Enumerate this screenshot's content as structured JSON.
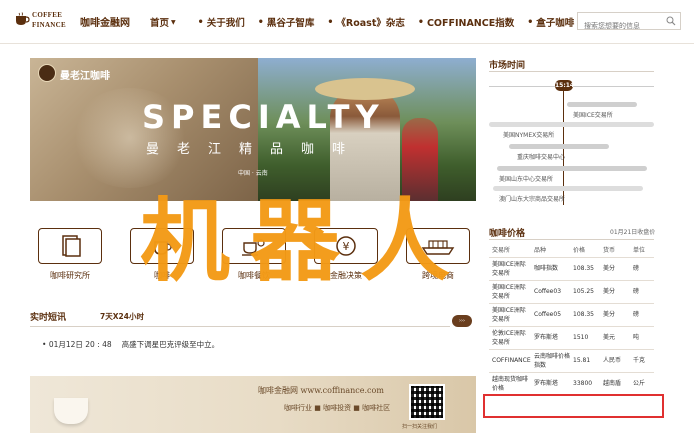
{
  "header": {
    "logo_line1": "COFFEE",
    "logo_line2": "FINANCE",
    "brand": "咖啡金融网",
    "nav": [
      {
        "label": "首页",
        "has_caret": true
      },
      {
        "label": "关于我们"
      },
      {
        "label": "黑谷子智库"
      },
      {
        "label": "《Roast》杂志"
      },
      {
        "label": "COFFINANCE指数"
      },
      {
        "label": "盒子咖啡"
      }
    ],
    "search_placeholder": "搜索您想要的信息",
    "colors": {
      "brand": "#5b2f0e"
    }
  },
  "banner": {
    "logo_text": "曼老江咖啡",
    "headline": "SPECIALTY",
    "subheadline": "曼老江精品咖啡",
    "location": "中国 · 云南"
  },
  "categories": [
    {
      "label": "咖啡研究所",
      "icon": "book-icon"
    },
    {
      "label": "咖啡",
      "icon": "coffee-icon"
    },
    {
      "label": "咖啡餐饮",
      "icon": "cup-icon"
    },
    {
      "label": "金融决策",
      "icon": "yen-icon"
    },
    {
      "label": "跨境电商",
      "icon": "ship-icon"
    }
  ],
  "news": {
    "title": "实时短讯",
    "subtitle": "7天X24小时",
    "items": [
      {
        "time": "01月12日 20 : 48",
        "text": "高盛下调星巴克评级至中立。"
      }
    ]
  },
  "ad": {
    "line1": "咖啡金融网 www.coffinance.com",
    "line2": "咖啡行业 ■ 咖啡投资 ■ 咖啡社区",
    "line3": "扫一扫关注我们"
  },
  "market_time": {
    "title": "市场时间",
    "now": "15:14",
    "markets": [
      "美国ICE交易所",
      "美国NYMEX交易所",
      "重庆咖啡交易中心",
      "美国山东中心交易所",
      "澳门山东大宗商品交易所"
    ]
  },
  "prices": {
    "title": "咖啡价格",
    "date": "01月21日收盘价",
    "columns": [
      "交易所",
      "品种",
      "价格",
      "货币",
      "单位"
    ],
    "rows": [
      [
        "美国ICE洲际交易所",
        "咖啡指数",
        "108.35",
        "美分",
        "磅"
      ],
      [
        "美国ICE洲际交易所",
        "Coffee03",
        "105.25",
        "美分",
        "磅"
      ],
      [
        "美国ICE洲际交易所",
        "Coffee05",
        "108.35",
        "美分",
        "磅"
      ],
      [
        "伦敦ICE洲际交易所",
        "罗布斯塔",
        "1510",
        "美元",
        "吨"
      ],
      [
        "COFFINANCE",
        "云南咖啡价格指数",
        "15.81",
        "人民币",
        "千克"
      ],
      [
        "越南现货咖啡价格",
        "罗布斯塔",
        "33800",
        "越南盾",
        "公斤"
      ]
    ],
    "highlight_color": "#e03030"
  },
  "watermark": "机器人"
}
